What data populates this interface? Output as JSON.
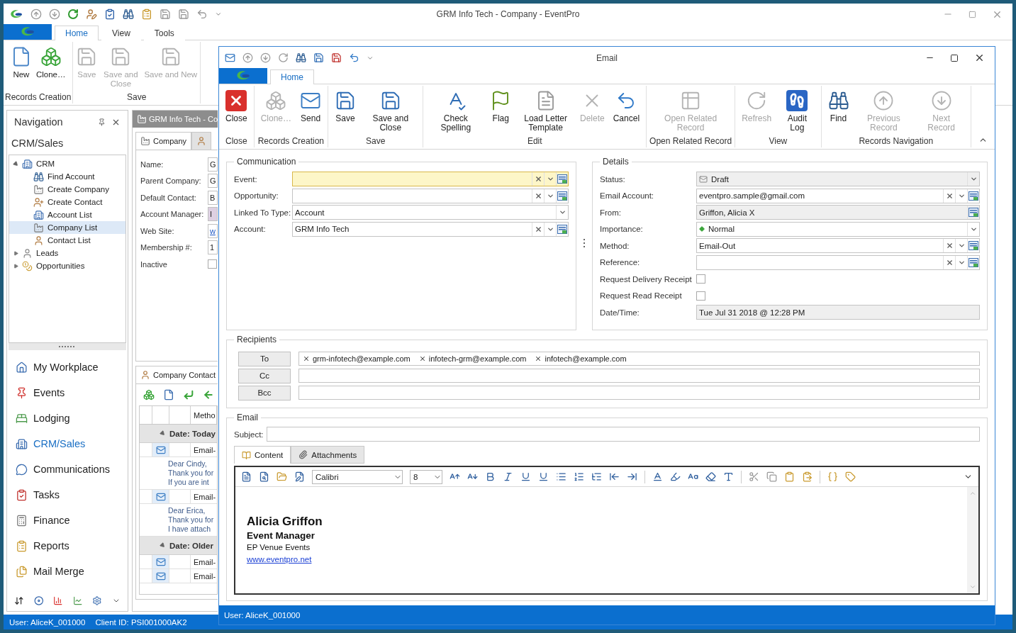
{
  "app": {
    "title": "GRM Info Tech - Company - EventPro",
    "ribbon_tabs": [
      {
        "label": "Home",
        "selected": true
      },
      {
        "label": "View",
        "selected": false
      },
      {
        "label": "Tools",
        "selected": false
      }
    ],
    "ribbon_groups": [
      {
        "label": "Records Creation",
        "buttons": [
          {
            "kind": "new",
            "label": "New",
            "disabled": false
          },
          {
            "kind": "clone",
            "label": "Clone…",
            "disabled": false
          }
        ]
      },
      {
        "label": "Save",
        "buttons": [
          {
            "kind": "save",
            "label": "Save",
            "disabled": true
          },
          {
            "kind": "saveclose",
            "label": "Save and Close",
            "disabled": true
          },
          {
            "kind": "savenew",
            "label": "Save and New",
            "disabled": true
          }
        ]
      }
    ],
    "navigation": {
      "title": "Navigation",
      "section": "CRM/Sales",
      "tree": [
        {
          "kind": "crm",
          "label": "CRM",
          "expanded": true,
          "selected": false,
          "children": [
            {
              "kind": "find",
              "label": "Find Account",
              "selected": false
            },
            {
              "kind": "newcompany",
              "label": "Create Company",
              "selected": false
            },
            {
              "kind": "newcontact",
              "label": "Create Contact",
              "selected": false
            },
            {
              "kind": "accounts",
              "label": "Account List",
              "selected": false
            },
            {
              "kind": "companies",
              "label": "Company List",
              "selected": true
            },
            {
              "kind": "contacts",
              "label": "Contact List",
              "selected": false
            }
          ]
        },
        {
          "kind": "leads",
          "label": "Leads",
          "expanded": false,
          "selected": false
        },
        {
          "kind": "opportunities",
          "label": "Opportunities",
          "expanded": false,
          "selected": false
        }
      ],
      "items": [
        {
          "kind": "home",
          "label": "My Workplace",
          "selected": false
        },
        {
          "kind": "events",
          "label": "Events",
          "selected": false
        },
        {
          "kind": "lodging",
          "label": "Lodging",
          "selected": false
        },
        {
          "kind": "crm",
          "label": "CRM/Sales",
          "selected": true
        },
        {
          "kind": "communications",
          "label": "Communications",
          "selected": false
        },
        {
          "kind": "tasks",
          "label": "Tasks",
          "selected": false
        },
        {
          "kind": "finance",
          "label": "Finance",
          "selected": false
        },
        {
          "kind": "reports",
          "label": "Reports",
          "selected": false
        },
        {
          "kind": "mailmerge",
          "label": "Mail Merge",
          "selected": false
        }
      ]
    },
    "document": {
      "title": "GRM Info Tech - Co",
      "tabs": [
        {
          "label": "Company",
          "selected": true
        },
        {
          "selected": false
        }
      ],
      "fields": [
        {
          "kind": "text",
          "label": "Name:",
          "value": "G",
          "highlighted": false
        },
        {
          "kind": "text",
          "label": "Parent Company:",
          "value": "G",
          "highlighted": false
        },
        {
          "kind": "text",
          "label": "Default Contact:",
          "value": "B",
          "highlighted": false
        },
        {
          "kind": "text",
          "label": "Account Manager:",
          "value": "I",
          "highlighted": true
        },
        {
          "kind": "link",
          "label": "Web Site:",
          "value": "w",
          "highlighted": false
        },
        {
          "kind": "text",
          "label": "Membership #:",
          "value": "1",
          "highlighted": false
        },
        {
          "kind": "checkbox",
          "label": "Inactive",
          "checked": false
        }
      ],
      "contacts": {
        "tab": "Company Contact",
        "column": "Metho",
        "groups": [
          {
            "label": "Date: Today",
            "rows": [
              {
                "method": "Email-",
                "preview": [
                  "Dear Cindy,",
                  "Thank you for",
                  "If you are int"
                ]
              },
              {
                "method": "Email-",
                "preview": [
                  "Dear Erica,",
                  "Thank you for",
                  "I have attach"
                ]
              }
            ]
          },
          {
            "label": "Date: Older",
            "rows": [
              {
                "method": "Email-"
              },
              {
                "method": "Email-"
              }
            ]
          }
        ]
      }
    },
    "status_bar": [
      "User: AliceK_001000",
      "Client ID: PSI001000AK2"
    ]
  },
  "email_window": {
    "title": "Email",
    "tabs": [
      {
        "label": "Home",
        "selected": true
      }
    ],
    "ribbon_groups": [
      {
        "label": "Close",
        "buttons": [
          {
            "kind": "close",
            "label": "Close",
            "disabled": false
          }
        ]
      },
      {
        "label": "Records Creation",
        "buttons": [
          {
            "kind": "clone",
            "label": "Clone…",
            "disabled": true
          },
          {
            "kind": "send",
            "label": "Send",
            "disabled": false
          }
        ]
      },
      {
        "label": "Save",
        "buttons": [
          {
            "kind": "save",
            "label": "Save",
            "disabled": false
          },
          {
            "kind": "saveclose",
            "label": "Save and Close",
            "disabled": false
          }
        ]
      },
      {
        "label": "Edit",
        "buttons": [
          {
            "kind": "spelling",
            "label": "Check Spelling",
            "disabled": false
          },
          {
            "kind": "flag",
            "label": "Flag",
            "disabled": false
          },
          {
            "kind": "template",
            "label": "Load Letter Template",
            "disabled": false
          },
          {
            "kind": "delete",
            "label": "Delete",
            "disabled": true
          },
          {
            "kind": "cancel",
            "label": "Cancel",
            "disabled": false
          }
        ]
      },
      {
        "label": "Open Related Record",
        "buttons": [
          {
            "kind": "related",
            "label": "Open Related Record",
            "disabled": true
          }
        ]
      },
      {
        "label": "View",
        "buttons": [
          {
            "kind": "refresh",
            "label": "Refresh",
            "disabled": true
          },
          {
            "kind": "audit",
            "label": "Audit Log",
            "disabled": false
          }
        ]
      },
      {
        "label": "Records Navigation",
        "buttons": [
          {
            "kind": "find",
            "label": "Find",
            "disabled": false
          },
          {
            "kind": "previous",
            "label": "Previous Record",
            "disabled": true
          },
          {
            "kind": "next",
            "label": "Next Record",
            "disabled": true
          }
        ]
      }
    ],
    "communication": {
      "title": "Communication",
      "fields": [
        {
          "kind": "lookup",
          "label": "Event:",
          "focused": true,
          "readonly": false
        },
        {
          "kind": "lookup",
          "label": "Opportunity:",
          "focused": false,
          "readonly": false
        },
        {
          "kind": "combo",
          "label": "Linked To Type:",
          "value": "Account",
          "focused": false,
          "readonly": false
        },
        {
          "kind": "lookup",
          "label": "Account:",
          "value": "GRM Info Tech",
          "focused": false,
          "readonly": false
        }
      ]
    },
    "details": {
      "title": "Details",
      "fields": [
        {
          "kind": "status",
          "label": "Status:",
          "value": "Draft",
          "focused": false,
          "readonly": true
        },
        {
          "kind": "lookup",
          "label": "Email Account:",
          "value": "eventpro.sample@gmail.com",
          "focused": false,
          "readonly": false
        },
        {
          "kind": "picker",
          "label": "From:",
          "value": "Griffon, Alicia X",
          "focused": false,
          "readonly": true
        },
        {
          "kind": "priority",
          "label": "Importance:",
          "value": "Normal",
          "focused": false,
          "readonly": false
        },
        {
          "kind": "lookup",
          "label": "Method:",
          "value": "Email-Out",
          "focused": false,
          "readonly": false
        },
        {
          "kind": "lookup",
          "label": "Reference:",
          "focused": false,
          "readonly": false
        },
        {
          "kind": "checkbox",
          "label": "Request Delivery Receipt",
          "checked": false
        },
        {
          "kind": "checkbox",
          "label": "Request Read Receipt",
          "checked": false
        },
        {
          "kind": "readonly",
          "label": "Date/Time:",
          "value": "Tue Jul 31 2018 @ 12:28 PM",
          "focused": false,
          "readonly": true
        }
      ]
    },
    "recipients": {
      "title": "Recipients",
      "rows": [
        {
          "label": "To",
          "addresses": [
            "grm-infotech@example.com",
            "infotech-grm@example.com",
            "infotech@example.com"
          ]
        },
        {
          "label": "Cc"
        },
        {
          "label": "Bcc"
        }
      ]
    },
    "email": {
      "title": "Email",
      "subject_label": "Subject:",
      "tabs": [
        {
          "label": "Content",
          "selected": true
        },
        {
          "label": "Attachments",
          "selected": false
        }
      ],
      "font": "Calibri",
      "font_size": "8",
      "signature": [
        {
          "kind": "name",
          "text": "Alicia Griffon"
        },
        {
          "kind": "title",
          "text": "Event Manager"
        },
        {
          "kind": "plain",
          "text": "EP Venue Events"
        },
        {
          "kind": "link",
          "text": "www.eventpro.net"
        }
      ]
    },
    "status_bar": "User: AliceK_001000"
  }
}
